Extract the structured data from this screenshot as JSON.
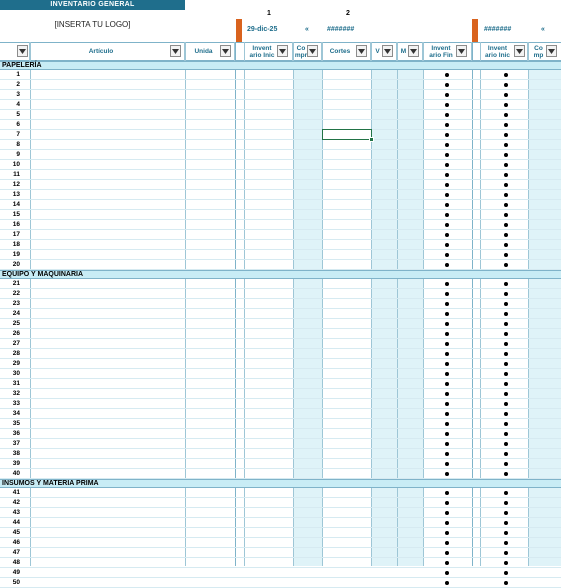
{
  "sheet": {
    "title": "INVENTARIO GENERAL",
    "logo_placeholder": "[INSERTA TU LOGO]",
    "periods": [
      {
        "number": "1",
        "label": "",
        "date": "29-dic-25",
        "arrow": "«",
        "hash": "#######"
      },
      {
        "number": "2",
        "label": "",
        "date": "#######",
        "arrow": "«",
        "hash": ""
      }
    ],
    "columns": {
      "articulo": "Artículo",
      "unidad": "Unida",
      "inv_inicial": "Invent\nario Inic",
      "compras": "Co\nmpr",
      "cortes": "Cortes",
      "v": "V",
      "m": "M",
      "inv_final": "Invent\nario Fin",
      "inv_inicial2": "Invent\nario Inic",
      "c2": "Co\nmp"
    },
    "sections": [
      {
        "name": "PAPELERÍA",
        "rows": [
          "1",
          "2",
          "3",
          "4",
          "5",
          "6",
          "7",
          "8",
          "9",
          "10",
          "11",
          "12",
          "13",
          "14",
          "15",
          "16",
          "17",
          "18",
          "19",
          "20"
        ]
      },
      {
        "name": "EQUIPO Y MAQUINARIA",
        "rows": [
          "21",
          "22",
          "23",
          "24",
          "25",
          "26",
          "27",
          "28",
          "29",
          "30",
          "31",
          "32",
          "33",
          "34",
          "35",
          "36",
          "37",
          "38",
          "39",
          "40"
        ]
      },
      {
        "name": "INSUMOS Y MATERIA PRIMA",
        "rows": [
          "41",
          "42",
          "43",
          "44",
          "45",
          "46",
          "47",
          "48",
          "49",
          "50"
        ]
      }
    ],
    "colors": {
      "accent": "#1f6e8c",
      "section_fill": "#c8ecf5",
      "input_fill": "#dff3f8",
      "period_marker": "#d9631e",
      "selection": "#217346"
    },
    "icons": {
      "filter": "filter-dropdown-icon",
      "formula_dot": "bullet-dot-icon"
    }
  }
}
